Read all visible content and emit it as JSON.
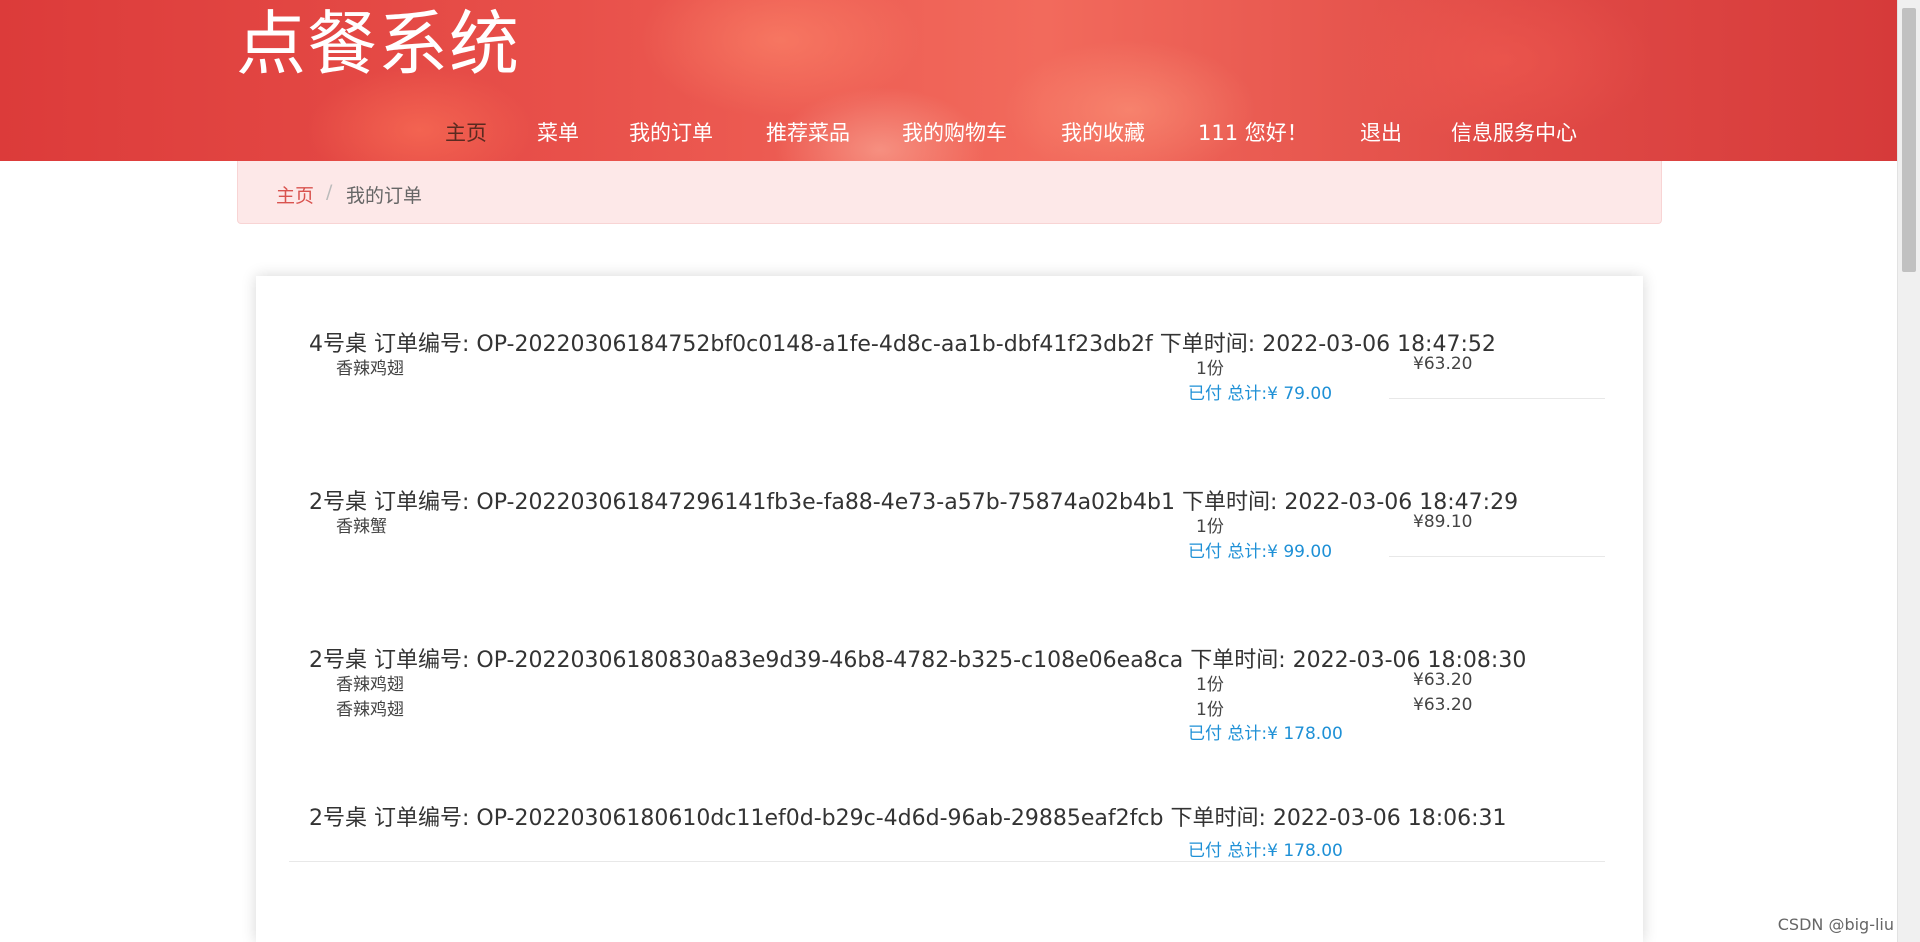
{
  "header": {
    "site_title": "点餐系统",
    "nav": [
      {
        "label": "主页",
        "active": true
      },
      {
        "label": "菜单",
        "active": false
      },
      {
        "label": "我的订单",
        "active": false
      },
      {
        "label": "推荐菜品",
        "active": false
      },
      {
        "label": "我的购物车",
        "active": false
      },
      {
        "label": "我的收藏",
        "active": false
      },
      {
        "label": "111 您好！",
        "active": false
      },
      {
        "label": "退出",
        "active": false
      },
      {
        "label": "信息服务中心",
        "active": false
      }
    ]
  },
  "breadcrumb": {
    "home": "主页",
    "separator": "/",
    "current": "我的订单"
  },
  "orders": [
    {
      "table": "4号桌",
      "order_no_label": "订单编号:",
      "order_no": "OP-20220306184752bf0c0148-a1fe-4d8c-aa1b-dbf41f23db2f",
      "time_label": "下单时间:",
      "time": "2022-03-06 18:47:52",
      "items": [
        {
          "name": "香辣鸡翅",
          "qty": "1份",
          "price": "¥63.20"
        }
      ],
      "summary": "已付 总计:¥ 79.00"
    },
    {
      "table": "2号桌",
      "order_no_label": "订单编号:",
      "order_no": "OP-202203061847296141fb3e-fa88-4e73-a57b-75874a02b4b1",
      "time_label": "下单时间:",
      "time": "2022-03-06 18:47:29",
      "items": [
        {
          "name": "香辣蟹",
          "qty": "1份",
          "price": "¥89.10"
        }
      ],
      "summary": "已付 总计:¥ 99.00"
    },
    {
      "table": "2号桌",
      "order_no_label": "订单编号:",
      "order_no": "OP-20220306180830a83e9d39-46b8-4782-b325-c108e06ea8ca",
      "time_label": "下单时间:",
      "time": "2022-03-06 18:08:30",
      "items": [
        {
          "name": "香辣鸡翅",
          "qty": "1份",
          "price": "¥63.20"
        },
        {
          "name": "香辣鸡翅",
          "qty": "1份",
          "price": "¥63.20"
        }
      ],
      "summary": "已付 总计:¥ 178.00"
    },
    {
      "table": "2号桌",
      "order_no_label": "订单编号:",
      "order_no": "OP-20220306180610dc11ef0d-b29c-4d6d-96ab-29885eaf2fcb",
      "time_label": "下单时间:",
      "time": "2022-03-06 18:06:31",
      "items": [],
      "summary": "已付 总计:¥ 178.00"
    }
  ],
  "watermark": "CSDN @big-liu"
}
